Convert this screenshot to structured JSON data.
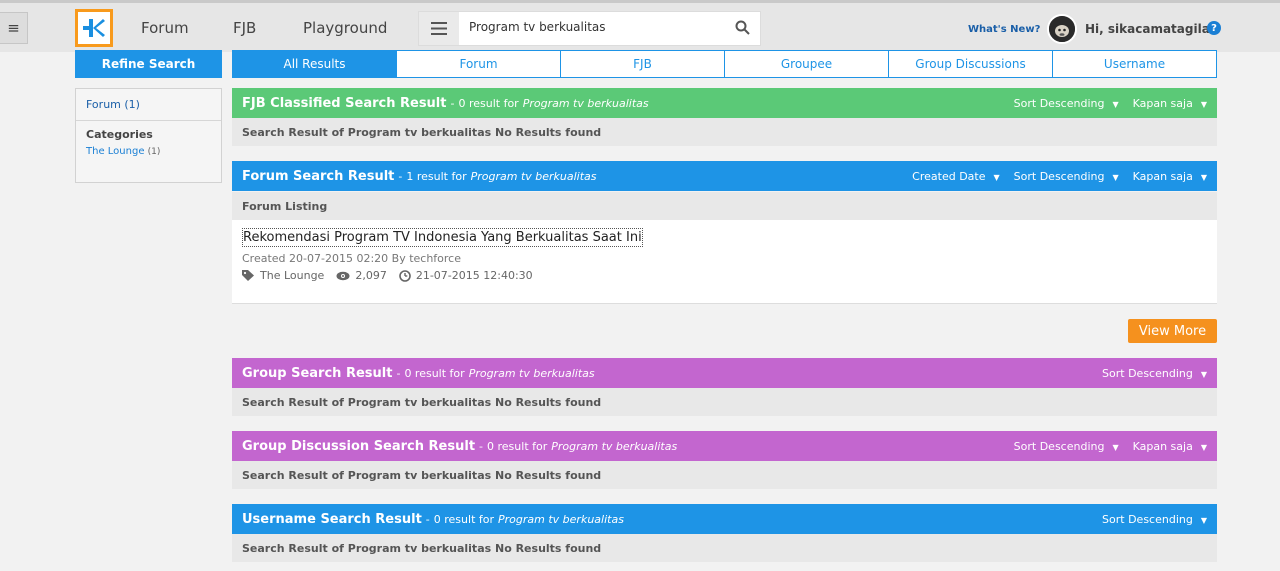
{
  "topbar": {
    "nav": {
      "forum": "Forum",
      "fjb": "FJB",
      "playground": "Playground"
    },
    "search": {
      "value": "Program tv berkualitas"
    },
    "whats_new": "What's New?",
    "greeting": "Hi, sikacamatagila"
  },
  "sidebar": {
    "refine_label": "Refine Search",
    "forum_filter": "Forum (1)",
    "categories_label": "Categories",
    "category": {
      "name": "The Lounge",
      "count": "(1)"
    }
  },
  "tabs": [
    "All Results",
    "Forum",
    "FJB",
    "Groupee",
    "Group Discussions",
    "Username"
  ],
  "sections": {
    "fjb": {
      "title": "FJB Classified Search Result",
      "count_text": "0 result for",
      "query": "Program tv berkualitas",
      "controls": [
        "Sort Descending",
        "Kapan saja"
      ],
      "no_results": "Search Result of Program tv berkualitas No Results found"
    },
    "forum": {
      "title": "Forum Search Result",
      "count_text": "1 result for",
      "query": "Program tv berkualitas",
      "controls": [
        "Created Date",
        "Sort Descending",
        "Kapan saja"
      ],
      "listing_label": "Forum Listing",
      "item": {
        "title": "Rekomendasi Program TV Indonesia Yang Berkualitas Saat Ini",
        "created": "Created 20-07-2015 02:20 By techforce",
        "category": "The Lounge",
        "views": "2,097",
        "last_post": "21-07-2015 12:40:30"
      },
      "view_more": "View More"
    },
    "group": {
      "title": "Group Search Result",
      "count_text": "0 result for",
      "query": "Program tv berkualitas",
      "controls": [
        "Sort Descending"
      ],
      "no_results": "Search Result of Program tv berkualitas No Results found"
    },
    "group_discussion": {
      "title": "Group Discussion Search Result",
      "count_text": "0 result for",
      "query": "Program tv berkualitas",
      "controls": [
        "Sort Descending",
        "Kapan saja"
      ],
      "no_results": "Search Result of Program tv berkualitas No Results found"
    },
    "username": {
      "title": "Username Search Result",
      "count_text": "0 result for",
      "query": "Program tv berkualitas",
      "controls": [
        "Sort Descending"
      ],
      "no_results": "Search Result of Program tv berkualitas No Results found"
    }
  },
  "colors": {
    "fjb": "#5bc977",
    "blue": "#1e94e6",
    "group": "#c366cf",
    "view_more": "#f5911e",
    "logo_border": "#f89a1c"
  }
}
